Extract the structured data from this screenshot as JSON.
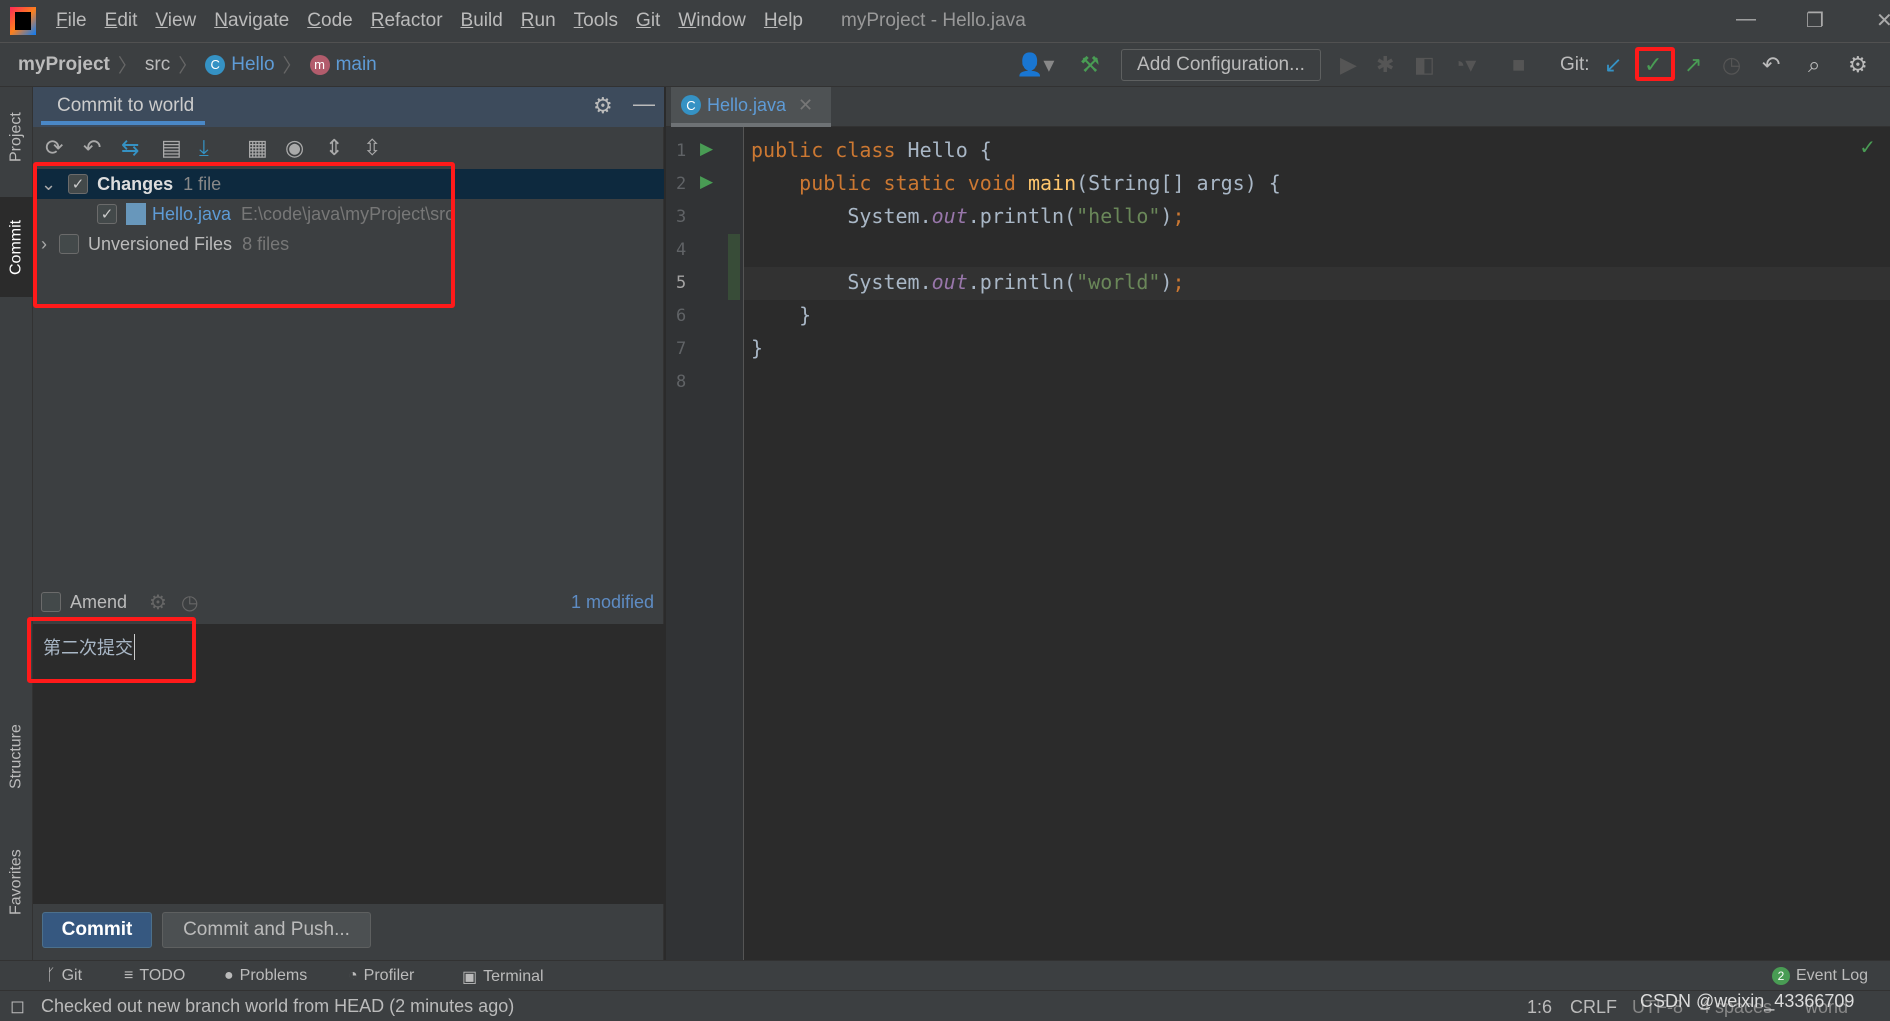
{
  "menubar": {
    "items": [
      "File",
      "Edit",
      "View",
      "Navigate",
      "Code",
      "Refactor",
      "Build",
      "Run",
      "Tools",
      "Git",
      "Window",
      "Help"
    ],
    "title": "myProject - Hello.java"
  },
  "navbar": {
    "breadcrumbs": [
      "myProject",
      "src",
      "Hello",
      "main"
    ],
    "add_configuration": "Add Configuration...",
    "git_label": "Git:"
  },
  "left_strip": {
    "tabs": [
      "Project",
      "Commit",
      "Structure",
      "Favorites"
    ]
  },
  "commit_panel": {
    "title": "Commit to world",
    "tree": {
      "changes": {
        "label": "Changes",
        "count": "1 file",
        "checked": true,
        "expanded": true
      },
      "file": {
        "name": "Hello.java",
        "path": "E:\\code\\java\\myProject\\src",
        "checked": true
      },
      "unversioned": {
        "label": "Unversioned Files",
        "count": "8 files",
        "checked": false,
        "expanded": false
      }
    },
    "amend_label": "Amend",
    "modified": "1 modified",
    "message": "第二次提交",
    "commit_button": "Commit",
    "commit_push_button": "Commit and Push..."
  },
  "editor": {
    "tab": "Hello.java",
    "line_numbers": [
      "1",
      "2",
      "3",
      "4",
      "5",
      "6",
      "7",
      "8"
    ],
    "lines": [
      [
        [
          "kw",
          "public class "
        ],
        [
          "",
          "Hello {"
        ]
      ],
      [
        [
          "",
          "    "
        ],
        [
          "kw",
          "public static void "
        ],
        [
          "fn",
          "main"
        ],
        [
          "",
          "(String[] args) {"
        ]
      ],
      [
        [
          "",
          "        System."
        ],
        [
          "fld",
          "out"
        ],
        [
          "",
          ".println("
        ],
        [
          "st",
          "\"hello\""
        ],
        [
          "",
          ")"
        ],
        [
          "kw",
          ";"
        ]
      ],
      [],
      [
        [
          "",
          "        System."
        ],
        [
          "fld",
          "out"
        ],
        [
          "",
          ".println("
        ],
        [
          "st",
          "\"world\""
        ],
        [
          "",
          ")"
        ],
        [
          "kw",
          ";"
        ]
      ],
      [
        [
          "",
          "    }"
        ]
      ],
      [
        [
          "",
          "}"
        ]
      ],
      []
    ]
  },
  "bottom_tools": [
    "Git",
    "TODO",
    "Problems",
    "Profiler",
    "Terminal"
  ],
  "event_log": {
    "label": "Event Log",
    "badge": "2"
  },
  "status": {
    "message": "Checked out new branch world from HEAD (2 minutes ago)",
    "position": "1:6",
    "line_sep": "CRLF",
    "encoding": "UTF-8",
    "indent": "4 spaces",
    "branch": "world",
    "watermark": "CSDN @weixin_43366709"
  },
  "colors": {
    "accent": "#4a88c7",
    "highlight_box": "#ff1a1a",
    "selected_row": "#0d293e"
  }
}
